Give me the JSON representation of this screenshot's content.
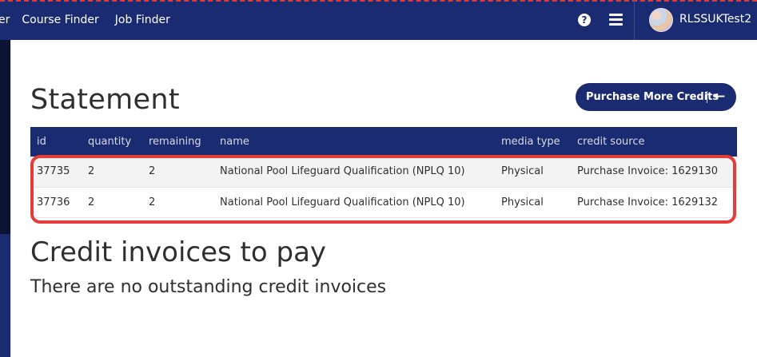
{
  "nav": {
    "links": [
      "er",
      "Course Finder",
      "Job Finder"
    ],
    "help_glyph": "?",
    "username": "RLSSUKTest2",
    "icons": [
      "help-icon",
      "menu-icon",
      "avatar"
    ]
  },
  "statement": {
    "title": "Statement",
    "purchase_button": "Purchase More Credits",
    "purchase_arrow": "←"
  },
  "table": {
    "headers": [
      "id",
      "quantity",
      "remaining",
      "name",
      "media type",
      "credit source"
    ],
    "rows": [
      [
        "37735",
        "2",
        "2",
        "National Pool Lifeguard Qualification (NPLQ 10)",
        "Physical",
        "Purchase Invoice: 1629130"
      ],
      [
        "37736",
        "2",
        "2",
        "National Pool Lifeguard Qualification (NPLQ 10)",
        "Physical",
        "Purchase Invoice: 1629132"
      ]
    ]
  },
  "invoices": {
    "title": "Credit invoices to pay",
    "empty_message": "There are no outstanding credit invoices"
  },
  "colors": {
    "brand_navy": "#1b2b72",
    "highlight_red": "#e43b3b"
  }
}
